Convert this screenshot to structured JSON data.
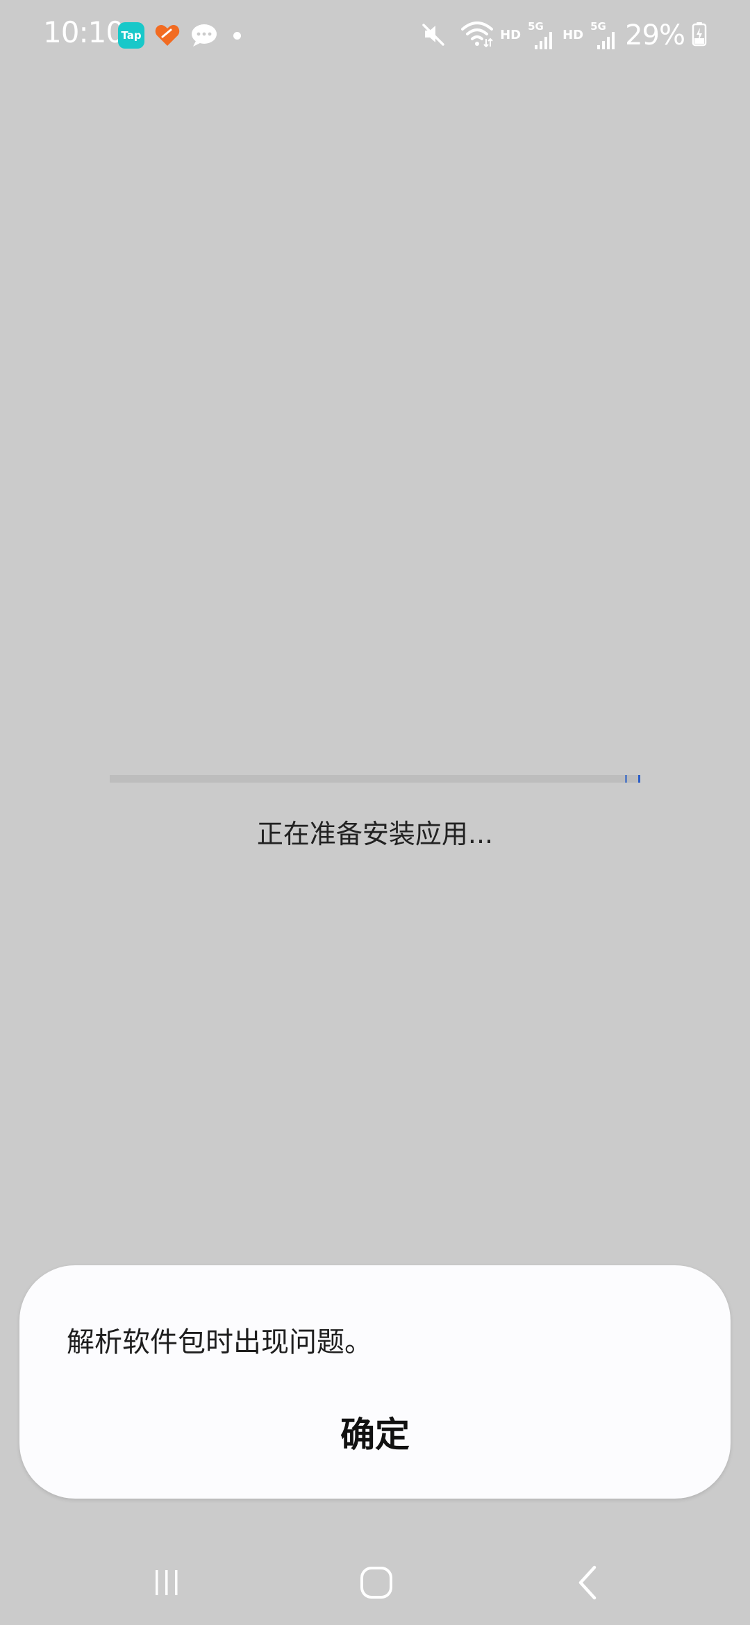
{
  "status_bar": {
    "time": "10:10",
    "notification_apps": {
      "tap_label": "Tap"
    },
    "hd_label_1": "HD",
    "network_label_1": "5G",
    "hd_label_2": "HD",
    "network_label_2": "5G",
    "battery": "29%"
  },
  "install": {
    "status_text": "正在准备安装应用...",
    "progress": 0.97
  },
  "dialog": {
    "message": "解析软件包时出现问题。",
    "ok_label": "确定"
  },
  "nav": {
    "recents": "recents-icon",
    "home": "home-icon",
    "back": "back-icon"
  },
  "colors": {
    "background": "#cbcbcb",
    "dialog": "#fcfcfe",
    "progress_accent": "#2a5ec8",
    "tap_app": "#18c8c9",
    "heart_app": "#f26b21"
  }
}
